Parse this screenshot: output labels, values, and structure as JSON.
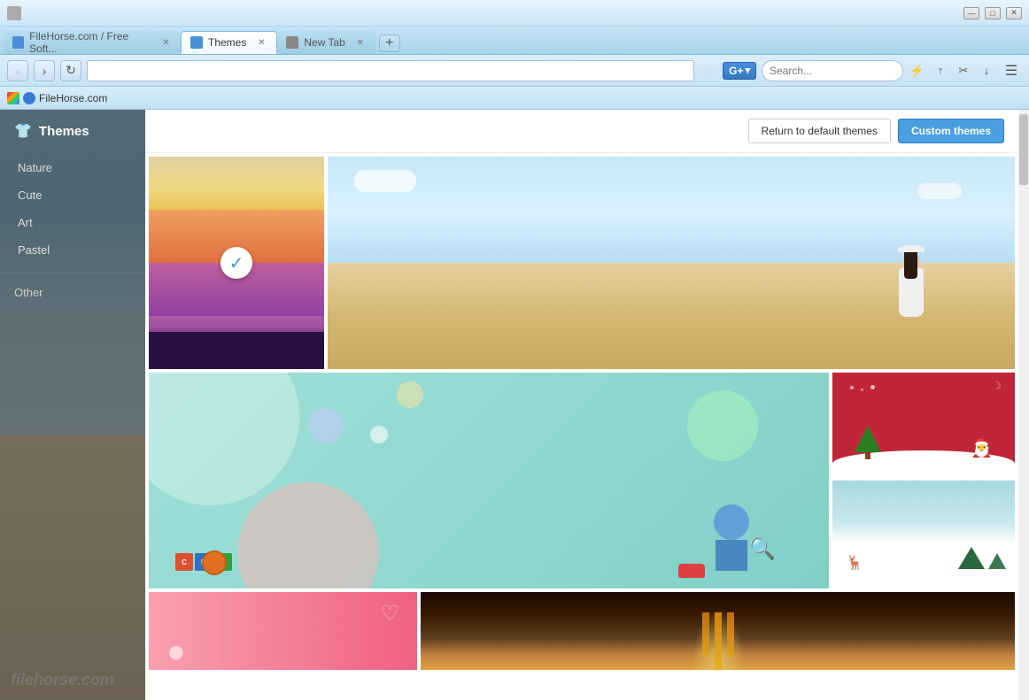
{
  "browser": {
    "title_bar": {
      "controls": [
        "minimize",
        "maximize",
        "close"
      ]
    },
    "tabs": [
      {
        "id": "tab1",
        "label": "FileHorse.com / Free Soft...",
        "favicon": "blue",
        "active": false
      },
      {
        "id": "tab2",
        "label": "Themes",
        "favicon": "blue",
        "active": true
      },
      {
        "id": "tab3",
        "label": "New Tab",
        "favicon": "grid",
        "active": false
      }
    ],
    "address": "",
    "new_tab_label": "+",
    "bookmarks": [
      {
        "label": "FileHorse.com",
        "type": "horse"
      }
    ]
  },
  "sidebar": {
    "header": {
      "title": "Themes",
      "icon": "shirt"
    },
    "items": [
      {
        "label": "Nature"
      },
      {
        "label": "Cute"
      },
      {
        "label": "Art"
      },
      {
        "label": "Pastel"
      }
    ],
    "other_label": "Other"
  },
  "content": {
    "buttons": {
      "return_default": "Return to default themes",
      "custom_themes": "Custom themes"
    },
    "themes": [
      {
        "id": "nature-sunset",
        "selected": true
      },
      {
        "id": "beach-girl",
        "selected": false
      },
      {
        "id": "cute-cartoon",
        "selected": false
      },
      {
        "id": "christmas-red",
        "selected": false
      },
      {
        "id": "winter-scene",
        "selected": false
      },
      {
        "id": "pink-cute",
        "selected": false
      },
      {
        "id": "dark-warm",
        "selected": false
      }
    ]
  },
  "watermark": {
    "text": "filehorse.com"
  }
}
